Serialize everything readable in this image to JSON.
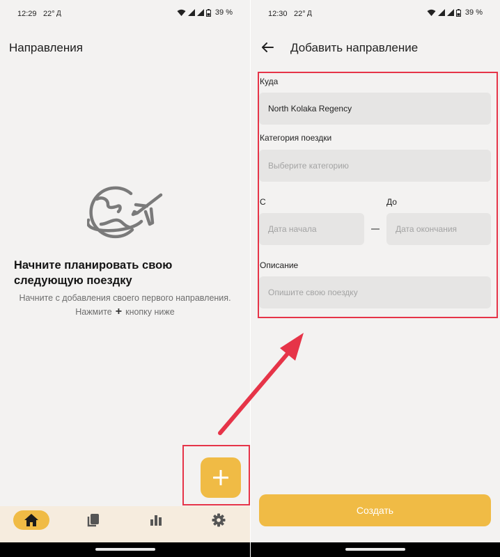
{
  "colors": {
    "accent": "#f0bb45",
    "background": "#f3f2f1",
    "nav_background": "#f6ecde",
    "field_background": "#e6e5e4",
    "annotation": "#e63448"
  },
  "left_screen": {
    "status_bar": {
      "time": "12:29",
      "temperature": "22°",
      "weather": "Д",
      "battery": "39 %"
    },
    "title": "Направления",
    "illustration_icon": "globe-with-airplane-icon",
    "empty_state": {
      "title": "Начните планировать свою следующую поездку",
      "description_line1": "Начните с добавления своего первого направления.",
      "description_line2_before": "Нажмите",
      "description_line2_icon": "+",
      "description_line2_after": "кнопку ниже"
    },
    "fab_icon": "plus-icon",
    "bottom_nav": {
      "items": [
        {
          "icon": "home-icon",
          "active": true
        },
        {
          "icon": "documents-icon",
          "active": false
        },
        {
          "icon": "bar-chart-icon",
          "active": false
        },
        {
          "icon": "gear-icon",
          "active": false
        }
      ]
    }
  },
  "right_screen": {
    "status_bar": {
      "time": "12:30",
      "temperature": "22°",
      "weather": "Д",
      "battery": "39 %"
    },
    "back_icon": "arrow-back-icon",
    "title": "Добавить направление",
    "form": {
      "destination": {
        "label": "Куда",
        "value": "North Kolaka Regency"
      },
      "category": {
        "label": "Категория поездки",
        "placeholder": "Выберите категорию"
      },
      "date_from": {
        "label": "С",
        "placeholder": "Дата начала"
      },
      "date_to": {
        "label": "До",
        "placeholder": "Дата окончания"
      },
      "description": {
        "label": "Описание",
        "placeholder": "Опишите свою поездку"
      }
    },
    "create_button": "Создать"
  }
}
